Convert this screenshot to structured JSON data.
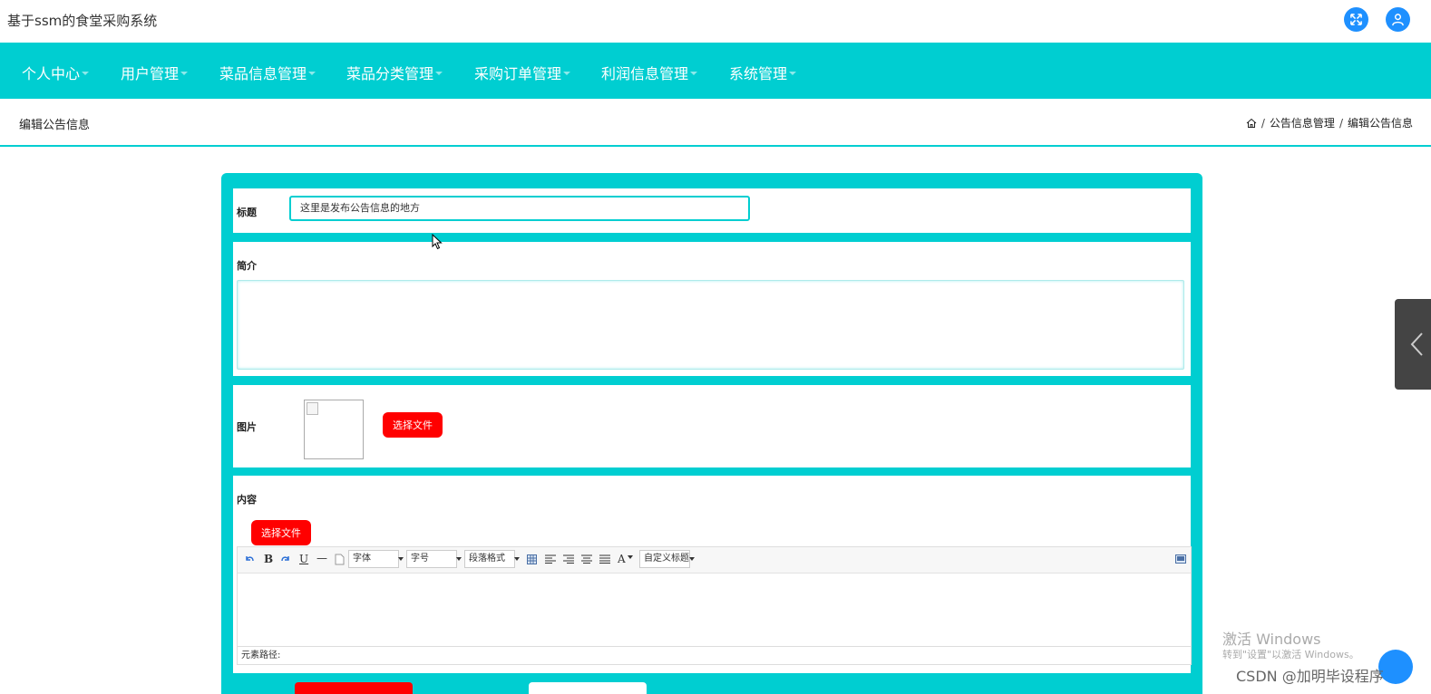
{
  "app": {
    "title": "基于ssm的食堂采购系统"
  },
  "top_actions": [
    {
      "icon": "fullscreen-icon"
    },
    {
      "icon": "user-icon"
    }
  ],
  "nav": {
    "items": [
      {
        "label": "个人中心"
      },
      {
        "label": "用户管理"
      },
      {
        "label": "菜品信息管理"
      },
      {
        "label": "菜品分类管理"
      },
      {
        "label": "采购订单管理"
      },
      {
        "label": "利润信息管理"
      },
      {
        "label": "系统管理"
      }
    ]
  },
  "header": {
    "page_title": "编辑公告信息",
    "breadcrumb": [
      "公告信息管理",
      "编辑公告信息"
    ]
  },
  "form": {
    "title_label": "标题",
    "title_value": "这里是发布公告信息的地方",
    "intro_label": "简介",
    "intro_value": "",
    "image_label": "图片",
    "image_button": "选择文件",
    "content_label": "内容",
    "content_button": "选择文件"
  },
  "editor": {
    "font_select": "字体",
    "size_select": "字号",
    "paragraph_select": "段落格式",
    "custom_title_select": "自定义标题",
    "status_text": "元素路径:"
  },
  "watermark": {
    "line1": "激活 Windows",
    "line2": "转到\"设置\"以激活 Windows。",
    "credit": "CSDN @加明毕设程序"
  },
  "colors": {
    "primary": "#00ced1",
    "button_red": "#ff0000",
    "icon_blue": "#1e90ff"
  }
}
